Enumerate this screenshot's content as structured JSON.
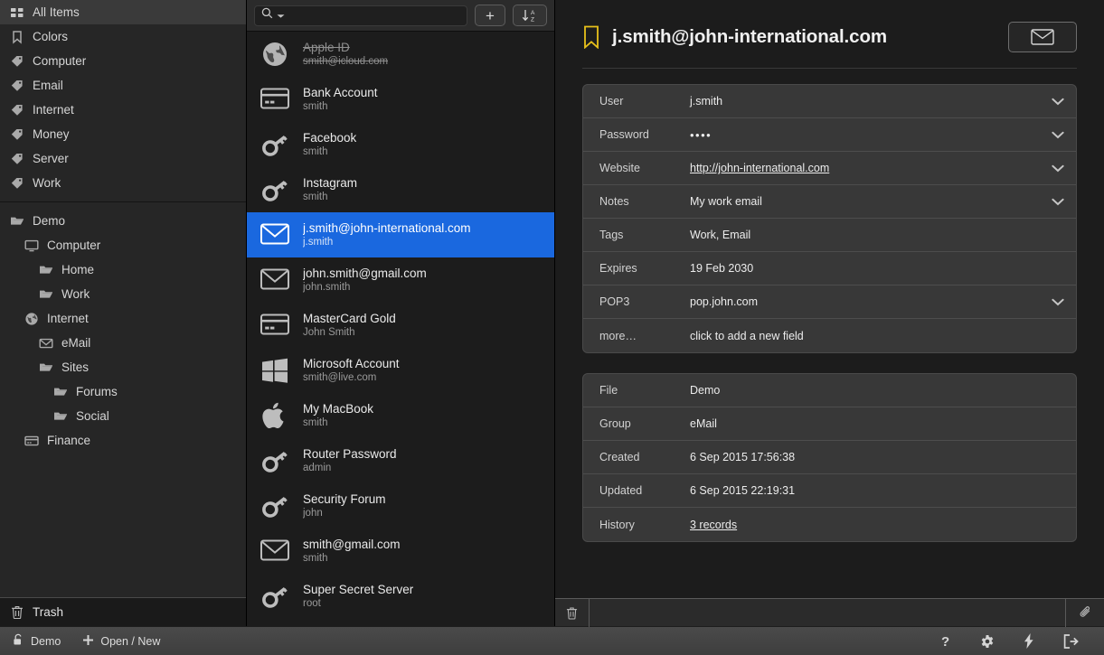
{
  "sidebar": {
    "groups": [
      {
        "items": [
          {
            "label": "All Items",
            "icon": "grid-icon",
            "indent": 0,
            "selected": true
          },
          {
            "label": "Colors",
            "icon": "bookmark-icon",
            "indent": 0,
            "selected": false
          },
          {
            "label": "Computer",
            "icon": "tag-icon",
            "indent": 0,
            "selected": false
          },
          {
            "label": "Email",
            "icon": "tag-icon",
            "indent": 0,
            "selected": false
          },
          {
            "label": "Internet",
            "icon": "tag-icon",
            "indent": 0,
            "selected": false
          },
          {
            "label": "Money",
            "icon": "tag-icon",
            "indent": 0,
            "selected": false
          },
          {
            "label": "Server",
            "icon": "tag-icon",
            "indent": 0,
            "selected": false
          },
          {
            "label": "Work",
            "icon": "tag-icon",
            "indent": 0,
            "selected": false
          }
        ]
      },
      {
        "items": [
          {
            "label": "Demo",
            "icon": "folder-icon",
            "indent": 0,
            "selected": false
          },
          {
            "label": "Computer",
            "icon": "monitor-icon",
            "indent": 1,
            "selected": false
          },
          {
            "label": "Home",
            "icon": "folder-icon",
            "indent": 2,
            "selected": false
          },
          {
            "label": "Work",
            "icon": "folder-icon",
            "indent": 2,
            "selected": false
          },
          {
            "label": "Internet",
            "icon": "globe-icon",
            "indent": 1,
            "selected": false
          },
          {
            "label": "eMail",
            "icon": "envelope-icon",
            "indent": 2,
            "selected": false
          },
          {
            "label": "Sites",
            "icon": "folder-icon",
            "indent": 2,
            "selected": false
          },
          {
            "label": "Forums",
            "icon": "folder-icon",
            "indent": 3,
            "selected": false
          },
          {
            "label": "Social",
            "icon": "folder-icon",
            "indent": 3,
            "selected": false
          },
          {
            "label": "Finance",
            "icon": "card-icon",
            "indent": 1,
            "selected": false
          }
        ]
      }
    ],
    "trash": {
      "label": "Trash",
      "icon": "trash-icon"
    }
  },
  "list": {
    "search": {
      "value": "",
      "placeholder": ""
    },
    "add_button_label": "+",
    "sort_button_label": "A-Z",
    "items": [
      {
        "title": "Apple ID",
        "subtitle": "smith@icloud.com",
        "icon": "globe-icon",
        "selected": false,
        "struck": true
      },
      {
        "title": "Bank Account",
        "subtitle": "smith",
        "icon": "card-icon",
        "selected": false,
        "struck": false
      },
      {
        "title": "Facebook",
        "subtitle": "smith",
        "icon": "key-icon",
        "selected": false,
        "struck": false
      },
      {
        "title": "Instagram",
        "subtitle": "smith",
        "icon": "key-icon",
        "selected": false,
        "struck": false
      },
      {
        "title": "j.smith@john-international.com",
        "subtitle": "j.smith",
        "icon": "envelope-icon",
        "selected": true,
        "struck": false
      },
      {
        "title": "john.smith@gmail.com",
        "subtitle": "john.smith",
        "icon": "envelope-icon",
        "selected": false,
        "struck": false
      },
      {
        "title": "MasterCard Gold",
        "subtitle": "John Smith",
        "icon": "card-icon",
        "selected": false,
        "struck": false
      },
      {
        "title": "Microsoft Account",
        "subtitle": "smith@live.com",
        "icon": "windows-icon",
        "selected": false,
        "struck": false
      },
      {
        "title": "My MacBook",
        "subtitle": "smith",
        "icon": "apple-icon",
        "selected": false,
        "struck": false
      },
      {
        "title": "Router Password",
        "subtitle": "admin",
        "icon": "key-icon",
        "selected": false,
        "struck": false
      },
      {
        "title": "Security Forum",
        "subtitle": "john",
        "icon": "key-icon",
        "selected": false,
        "struck": false
      },
      {
        "title": "smith@gmail.com",
        "subtitle": "smith",
        "icon": "envelope-icon",
        "selected": false,
        "struck": false
      },
      {
        "title": "Super Secret Server",
        "subtitle": "root",
        "icon": "key-icon",
        "selected": false,
        "struck": false
      }
    ]
  },
  "detail": {
    "title": "j.smith@john-international.com",
    "bookmark_icon": "bookmark-icon",
    "bookmark_color": "#e8c11a",
    "action_button_icon": "envelope-icon",
    "fields": [
      {
        "key": "User",
        "value": "j.smith",
        "chevron": true,
        "link": false,
        "dots": false
      },
      {
        "key": "Password",
        "value": "••••",
        "chevron": true,
        "link": false,
        "dots": true
      },
      {
        "key": "Website",
        "value": "http://john-international.com",
        "chevron": true,
        "link": true,
        "dots": false
      },
      {
        "key": "Notes",
        "value": "My work email",
        "chevron": true,
        "link": false,
        "dots": false
      },
      {
        "key": "Tags",
        "value": "Work, Email",
        "chevron": false,
        "link": false,
        "dots": false
      },
      {
        "key": "Expires",
        "value": "19 Feb 2030",
        "chevron": false,
        "link": false,
        "dots": false
      },
      {
        "key": "POP3",
        "value": "pop.john.com",
        "chevron": true,
        "link": false,
        "dots": false
      },
      {
        "key": "more…",
        "value": "click to add a new field",
        "chevron": false,
        "link": false,
        "dots": false
      }
    ],
    "meta": [
      {
        "key": "File",
        "value": "Demo",
        "link": false
      },
      {
        "key": "Group",
        "value": "eMail",
        "link": false
      },
      {
        "key": "Created",
        "value": "6 Sep 2015 17:56:38",
        "link": false
      },
      {
        "key": "Updated",
        "value": "6 Sep 2015 22:19:31",
        "link": false
      },
      {
        "key": "History",
        "value": "3 records",
        "link": true
      }
    ],
    "footer": {
      "delete_icon": "trash-icon",
      "attach_icon": "paperclip-icon"
    }
  },
  "statusbar": {
    "file_label": "Demo",
    "file_icon": "unlock-icon",
    "open_new_label": "Open / New",
    "open_new_icon": "plus-icon",
    "icons": [
      {
        "name": "help-icon",
        "glyph": "?"
      },
      {
        "name": "gear-icon",
        "glyph": "gear"
      },
      {
        "name": "lightning-icon",
        "glyph": "bolt"
      },
      {
        "name": "logout-icon",
        "glyph": "exit"
      }
    ]
  }
}
